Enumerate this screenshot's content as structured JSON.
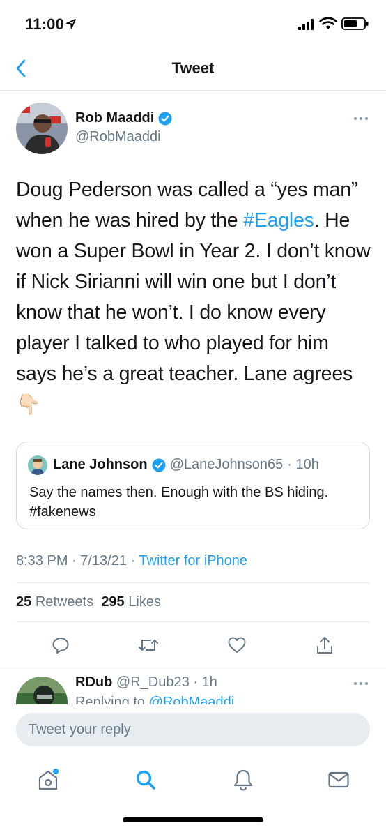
{
  "status_bar": {
    "time": "11:00"
  },
  "nav": {
    "title": "Tweet"
  },
  "tweet": {
    "author_name": "Rob Maaddi",
    "author_handle": "@RobMaaddi",
    "text_before_hashtag": "Doug Pederson was called a “yes man” when he was hired by the ",
    "hashtag": "#Eagles",
    "text_after_hashtag": ". He won a Super Bowl in Year 2. I don’t know if Nick Sirianni will win one but I don’t know that he won’t. I do know every player I talked to who played for him says he’s a great teacher. Lane agrees ",
    "emoji": "👇🏻",
    "quote": {
      "name": "Lane Johnson",
      "handle": "@LaneJohnson65",
      "time": "· 10h",
      "text": "Say the names then. Enough with the BS hiding. #fakenews"
    },
    "timestamp": "8:33 PM · 7/13/21 · ",
    "source": "Twitter for iPhone",
    "retweets_count": "25",
    "retweets_label": "Retweets",
    "likes_count": "295",
    "likes_label": "Likes"
  },
  "reply_preview": {
    "name": "RDub",
    "handle": "@R_Dub23",
    "time": "· 1h",
    "replying_prefix": "Replying to ",
    "replying_to": "@RobMaaddi"
  },
  "composer": {
    "placeholder": "Tweet your reply"
  },
  "colors": {
    "accent": "#1da1f2",
    "muted": "#657786",
    "text": "#14171a",
    "divider": "#e1e8ed"
  },
  "icons": {
    "actions": [
      "reply-icon",
      "retweet-icon",
      "like-icon",
      "share-icon"
    ],
    "tabs": [
      "home-icon",
      "search-icon",
      "notifications-icon",
      "messages-icon"
    ]
  }
}
